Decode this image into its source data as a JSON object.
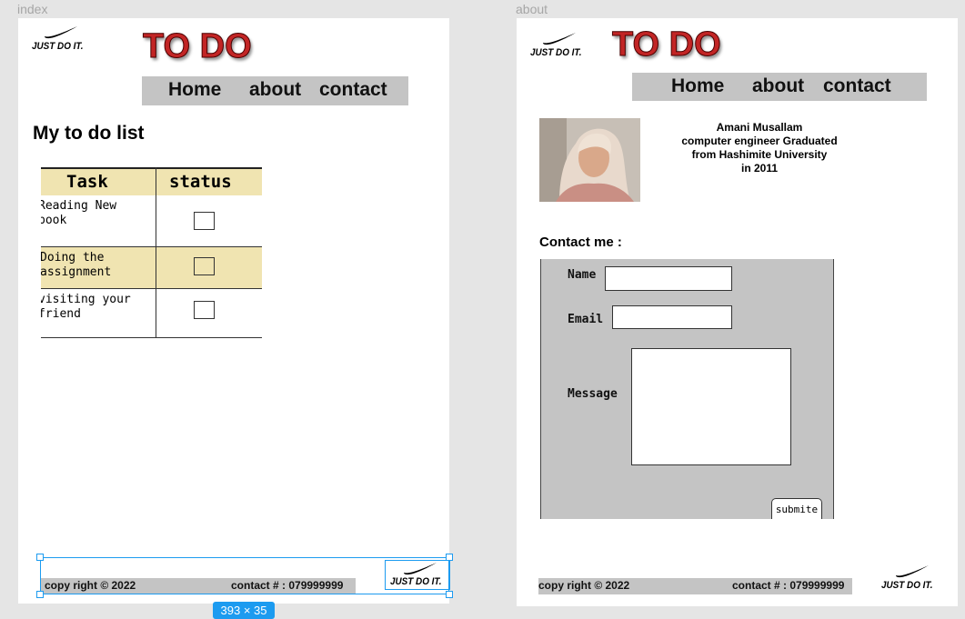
{
  "frames": {
    "index_label": "index",
    "about_label": "about"
  },
  "brand": {
    "slogan": "JUST DO IT.",
    "title": "TO DO"
  },
  "nav": {
    "home": "Home",
    "about": "about",
    "contact": "contact"
  },
  "index": {
    "heading": "My to do list",
    "table": {
      "headers": [
        "Task",
        "status"
      ],
      "rows": [
        {
          "task": "Reading New book",
          "checked": false
        },
        {
          "task": "Doing the assignment",
          "checked": false
        },
        {
          "task": "visiting your friend",
          "checked": false
        }
      ]
    }
  },
  "about": {
    "bio_lines": [
      "Amani Musallam",
      "computer engineer Graduated",
      "from Hashimite University",
      "in 2011"
    ],
    "contact_heading": "Contact me :",
    "form": {
      "name_label": "Name",
      "email_label": "Email",
      "message_label": "Message",
      "submit_label": "submite"
    }
  },
  "footer": {
    "copyright": "copy right © 2022",
    "contact": "contact # : 079999999"
  },
  "selection": {
    "dimensions": "393 × 35"
  },
  "colors": {
    "canvas": "#e5e5e5",
    "title_red": "#c22525",
    "nav_gray": "#c4c4c4",
    "table_highlight": "#f0e4b1",
    "selection_blue": "#1c9bf0"
  }
}
